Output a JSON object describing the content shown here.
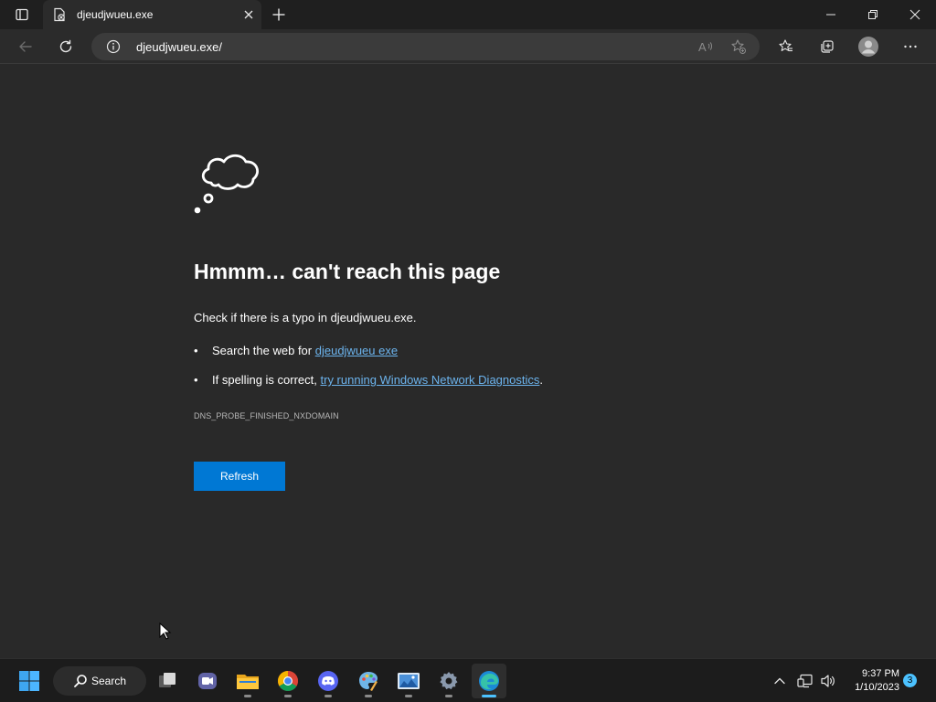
{
  "browser": {
    "tab_title": "djeudjwueu.exe",
    "address": "djeudjwueu.exe/"
  },
  "error_page": {
    "headline": "Hmmm… can't reach this page",
    "check_text": "Check if there is a typo in djeudjwueu.exe.",
    "suggestion1_prefix": "Search the web for ",
    "suggestion1_link": "djeudjwueu exe",
    "suggestion2_prefix": "If spelling is correct, ",
    "suggestion2_link": "try running Windows Network Diagnostics",
    "suggestion2_suffix": ".",
    "error_code": "DNS_PROBE_FINISHED_NXDOMAIN",
    "refresh_label": "Refresh"
  },
  "taskbar": {
    "search_label": "Search",
    "time": "9:37 PM",
    "date": "1/10/2023",
    "notification_count": "3",
    "icons": [
      "windows-start-icon",
      "search-icon",
      "task-view-icon",
      "teams-chat-icon",
      "file-explorer-icon",
      "chrome-icon",
      "discord-icon",
      "paint-icon",
      "photos-icon",
      "settings-icon",
      "edge-icon"
    ]
  },
  "colors": {
    "accent": "#0078d4",
    "link": "#6cb4ee",
    "page_background": "#292929",
    "active_indicator": "#4cc2ff"
  }
}
